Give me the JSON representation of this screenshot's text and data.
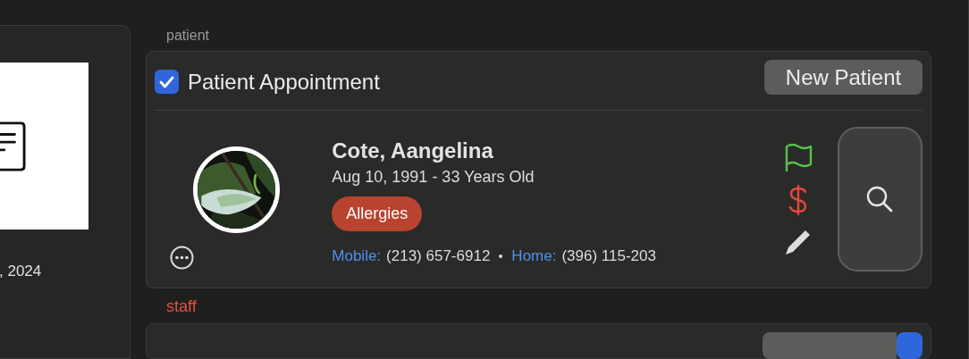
{
  "left_panel": {
    "date": ", 2024"
  },
  "patient_section": {
    "label": "patient",
    "appointment": {
      "label": "Patient Appointment",
      "checked": true
    },
    "new_button": "New Patient",
    "patient": {
      "name": "Cote, Aangelina",
      "birth": "Aug 10, 1991 - 33 Years Old",
      "tag": "Allergies",
      "phones": [
        {
          "label": "Mobile:",
          "number": "(213) 657-6912"
        },
        {
          "label": "Home:",
          "number": "(396) 115-203"
        }
      ]
    }
  },
  "staff_section": {
    "label": "staff"
  }
}
